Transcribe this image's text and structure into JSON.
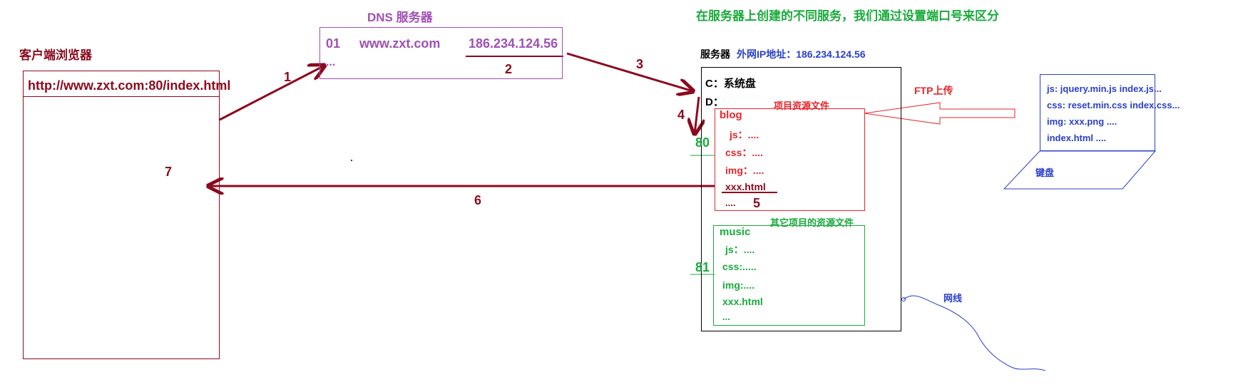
{
  "title": "在服务器上创建的不同服务，我们通过设置端口号来区分",
  "client": {
    "heading": "客户端浏览器",
    "url": "http://www.zxt.com:80/index.html"
  },
  "dns": {
    "heading": "DNS 服务器",
    "row_index": "01",
    "domain": "www.zxt.com",
    "ip": "186.234.124.56",
    "more": "..."
  },
  "server": {
    "heading": "服务器",
    "ip_label": "外网IP地址：186.234.124.56",
    "drive_c": "C：系统盘",
    "drive_d": "D："
  },
  "blog_project": {
    "caption": "项目资源文件",
    "name": "blog",
    "files": [
      "js：....",
      "css：....",
      "img：....",
      "xxx.html",
      "...."
    ],
    "port": "80"
  },
  "music_project": {
    "caption": "其它项目的资源文件",
    "name": "music",
    "files": [
      "js：....",
      "css:.....",
      "img:....",
      "xxx.html",
      "..."
    ],
    "port": "81"
  },
  "ftp": {
    "label": "FTP上传"
  },
  "keyboard": {
    "lines": [
      "js:  jquery.min.js   index.js...",
      "css: reset.min.css   index.css...",
      "img: xxx.png ....",
      "index.html  ...."
    ],
    "label": "键盘"
  },
  "network": {
    "label": "网线"
  },
  "steps": [
    "1",
    "2",
    "3",
    "4",
    "5",
    "6",
    "7"
  ],
  "colors": {
    "dark_red": "#8b0a1e",
    "red": "#e8252b",
    "purple": "#a050b4",
    "green": "#1aab3c",
    "blue": "#2b3fc8",
    "black": "#000000"
  }
}
